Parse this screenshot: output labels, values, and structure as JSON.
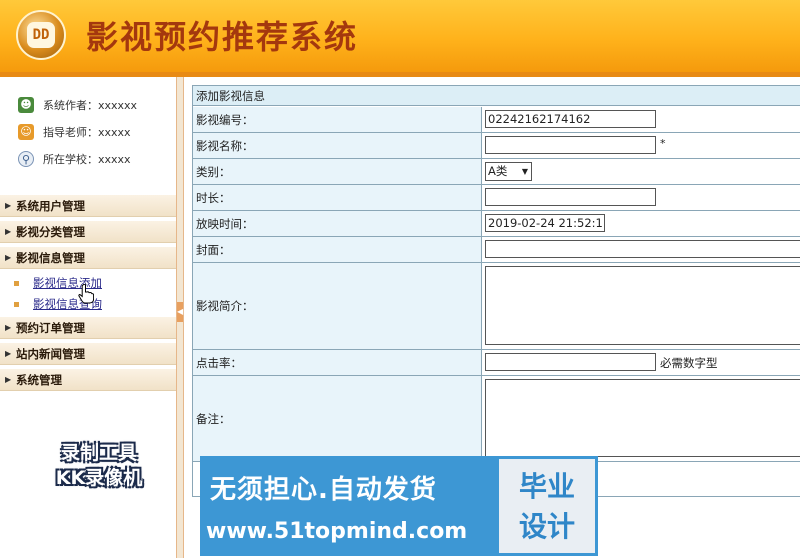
{
  "app": {
    "title": "影视预约推荐系统",
    "logo_text": "DD"
  },
  "sidebar": {
    "info": [
      {
        "icon": "users-icon",
        "text": "系统作者：xxxxxx"
      },
      {
        "icon": "teacher-icon",
        "text": "指导老师：xxxxx"
      },
      {
        "icon": "school-icon",
        "text": "所在学校：xxxxx"
      }
    ],
    "menus": [
      {
        "label": "系统用户管理"
      },
      {
        "label": "影视分类管理"
      },
      {
        "label": "影视信息管理"
      },
      {
        "label": "预约订单管理"
      },
      {
        "label": "站内新闻管理"
      },
      {
        "label": "系统管理"
      }
    ],
    "submenu": [
      {
        "label": "影视信息添加"
      },
      {
        "label": "影视信息查询"
      }
    ]
  },
  "watermark": {
    "line1": "录制工具",
    "line2": "KK录像机"
  },
  "form": {
    "title": "添加影视信息",
    "fields": {
      "code": {
        "label": "影视编号：",
        "value": "02242162174162"
      },
      "name": {
        "label": "影视名称：",
        "value": "",
        "required": "*"
      },
      "category": {
        "label": "类别：",
        "value": "A类"
      },
      "duration": {
        "label": "时长：",
        "value": ""
      },
      "showtime": {
        "label": "放映时间：",
        "value": "2019-02-24 21:52:1"
      },
      "cover": {
        "label": "封面：",
        "value": ""
      },
      "intro": {
        "label": "影视简介：",
        "value": ""
      },
      "clicks": {
        "label": "点击率：",
        "value": "",
        "hint": "必需数字型"
      },
      "remark": {
        "label": "备注：",
        "value": ""
      }
    }
  },
  "ad": {
    "line1": "无须担心.自动发货",
    "line2": "www.51topmind.com",
    "side_line1": "毕业",
    "side_line2": "设计"
  }
}
